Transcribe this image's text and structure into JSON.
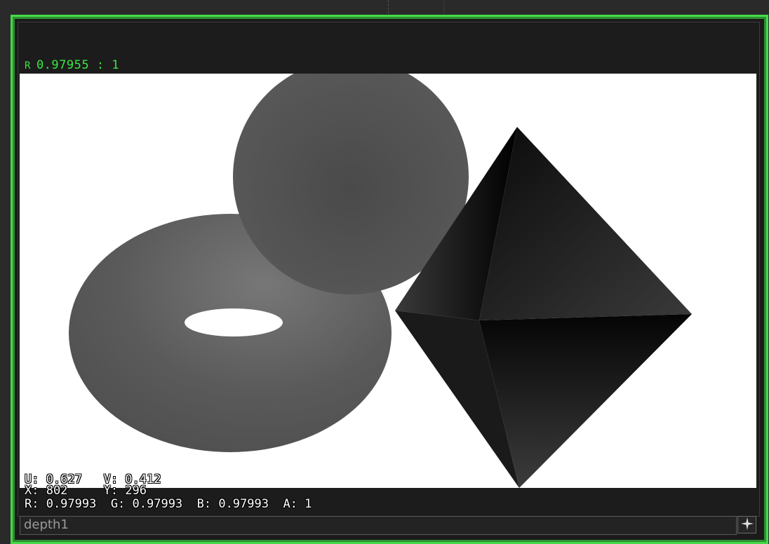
{
  "viewer": {
    "range_channel": "R",
    "range_text": "0.97955 : 1",
    "operator_name": "depth1"
  },
  "pixel_probe": {
    "uv_line": "U: 0.627   V: 0.412",
    "xy_line": "X: 802     Y: 296",
    "rgba_line": "R: 0.97993  G: 0.97993  B: 0.97993  A: 1"
  },
  "icons": {
    "pin": "star-pin-icon"
  },
  "colors": {
    "selection_frame": "#45d94a",
    "range_text": "#39e83f",
    "background": "#ffffff"
  }
}
